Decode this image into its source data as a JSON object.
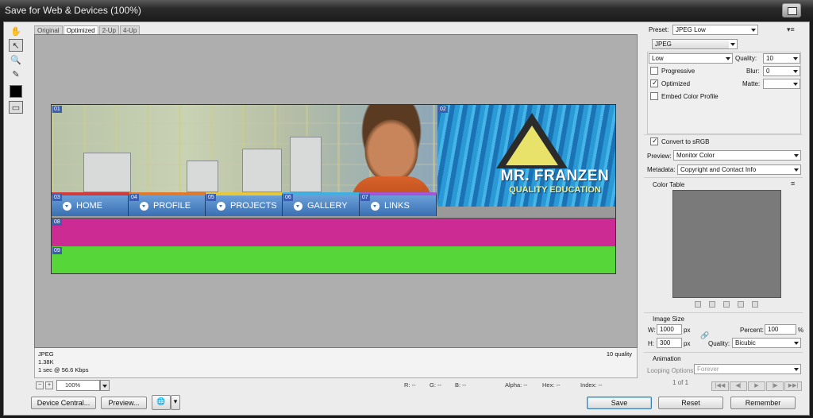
{
  "window": {
    "title": "Save for Web & Devices (100%)"
  },
  "tabs": [
    "Original",
    "Optimized",
    "2-Up",
    "4-Up"
  ],
  "banner": {
    "brand": "MR. FRANZEN",
    "tagline": "QUALITY EDUCATION",
    "logo_mark": "FRANZEN",
    "nav": [
      "HOME",
      "PROFILE",
      "PROJECTS",
      "GALLERY",
      "LINKS"
    ],
    "nav_colors": [
      "#d23b3b",
      "#e07a2a",
      "#e8c83a",
      "#3fb0e0",
      "#a456d6"
    ],
    "slices": [
      "01",
      "02",
      "03",
      "04",
      "05",
      "06",
      "07",
      "08",
      "09"
    ]
  },
  "info": {
    "format": "JPEG",
    "size": "1.38K",
    "speed": "1 sec @ 56.6 Kbps",
    "quality_note": "10 quality"
  },
  "status": {
    "zoom": "100%",
    "r": "R: --",
    "g": "G: --",
    "b": "B: --",
    "alpha": "Alpha: --",
    "hex": "Hex: --",
    "index": "Index: --"
  },
  "buttons": {
    "device_central": "Device Central...",
    "preview": "Preview...",
    "save": "Save",
    "reset": "Reset",
    "remember": "Remember"
  },
  "settings": {
    "preset_label": "Preset:",
    "preset_value": "JPEG Low",
    "format_value": "JPEG",
    "quality_level": "Low",
    "quality_label": "Quality:",
    "quality_value": "10",
    "progressive": "Progressive",
    "blur_label": "Blur:",
    "blur_value": "0",
    "optimized": "Optimized",
    "matte_label": "Matte:",
    "embed_profile": "Embed Color Profile",
    "convert_srgb": "Convert to sRGB",
    "preview_label": "Preview:",
    "preview_value": "Monitor Color",
    "metadata_label": "Metadata:",
    "metadata_value": "Copyright and Contact Info",
    "color_table_label": "Color Table",
    "image_size_label": "Image Size",
    "w_label": "W:",
    "w_value": "1000",
    "h_label": "H:",
    "h_value": "300",
    "px": "px",
    "percent_label": "Percent:",
    "percent_value": "100",
    "percent_sign": "%",
    "resample_label": "Quality:",
    "resample_value": "Bicubic",
    "animation_label": "Animation",
    "looping_label": "Looping Options:",
    "looping_value": "Forever",
    "frame_counter": "1 of 1"
  },
  "colors": {
    "magenta": "#cc2b93",
    "green": "#57d63a",
    "banner_blue": "#2a9ad6"
  }
}
